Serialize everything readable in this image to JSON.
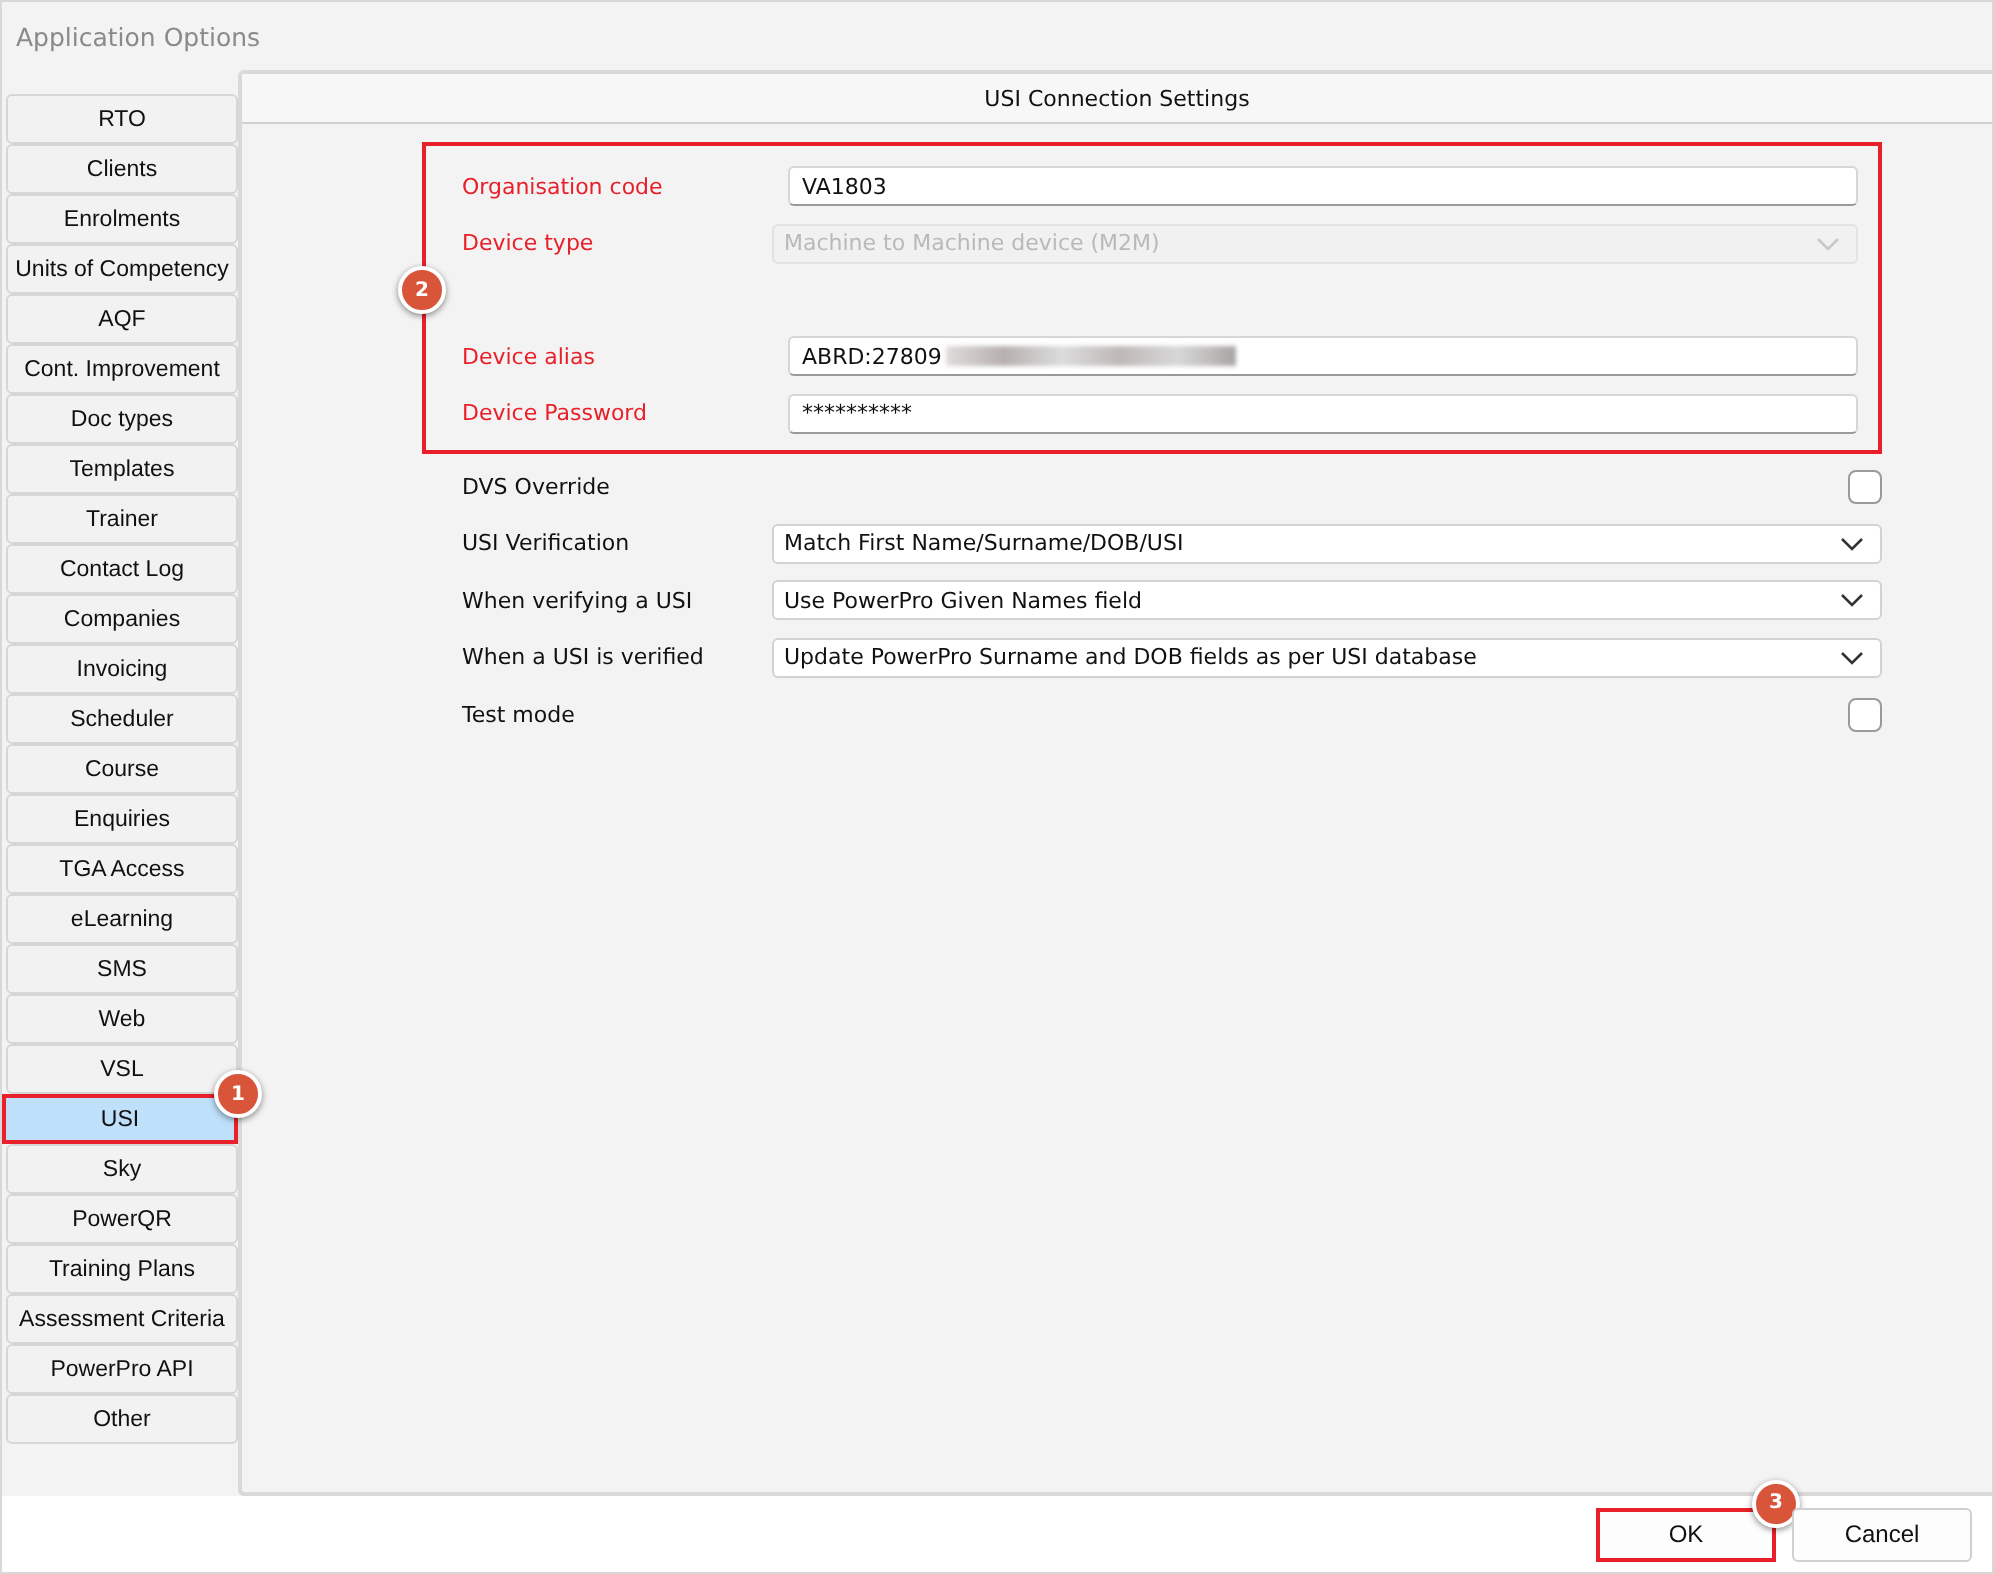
{
  "window": {
    "title": "Application Options"
  },
  "sidebar": {
    "items": [
      {
        "label": "RTO",
        "selected": false
      },
      {
        "label": "Clients",
        "selected": false
      },
      {
        "label": "Enrolments",
        "selected": false
      },
      {
        "label": "Units of Competency",
        "selected": false
      },
      {
        "label": "AQF",
        "selected": false
      },
      {
        "label": "Cont. Improvement",
        "selected": false
      },
      {
        "label": "Doc types",
        "selected": false
      },
      {
        "label": "Templates",
        "selected": false
      },
      {
        "label": "Trainer",
        "selected": false
      },
      {
        "label": "Contact Log",
        "selected": false
      },
      {
        "label": "Companies",
        "selected": false
      },
      {
        "label": "Invoicing",
        "selected": false
      },
      {
        "label": "Scheduler",
        "selected": false
      },
      {
        "label": "Course",
        "selected": false
      },
      {
        "label": "Enquiries",
        "selected": false
      },
      {
        "label": "TGA Access",
        "selected": false
      },
      {
        "label": "eLearning",
        "selected": false
      },
      {
        "label": "SMS",
        "selected": false
      },
      {
        "label": "Web",
        "selected": false
      },
      {
        "label": "VSL",
        "selected": false
      },
      {
        "label": "USI",
        "selected": true,
        "callout": "1"
      },
      {
        "label": "Sky",
        "selected": false
      },
      {
        "label": "PowerQR",
        "selected": false
      },
      {
        "label": "Training Plans",
        "selected": false
      },
      {
        "label": "Assessment Criteria",
        "selected": false
      },
      {
        "label": "PowerPro API",
        "selected": false
      },
      {
        "label": "Other",
        "selected": false
      }
    ]
  },
  "panel": {
    "title": "USI Connection Settings",
    "highlighted_group": {
      "callout": "2",
      "fields": [
        {
          "kind": "text",
          "label": "Organisation code",
          "value": "VA1803"
        },
        {
          "kind": "select",
          "label": "Device type",
          "value": "Machine to Machine device (M2M)",
          "disabled": true
        },
        {
          "kind": "spacer"
        },
        {
          "kind": "text",
          "label": "Device alias",
          "value": "ABRD:27809",
          "redacted": true
        },
        {
          "kind": "text",
          "label": "Device Password",
          "value": "**********"
        }
      ]
    },
    "fields": [
      {
        "kind": "checkbox",
        "label": "DVS Override",
        "checked": false
      },
      {
        "kind": "select",
        "label": "USI Verification",
        "value": "Match First Name/Surname/DOB/USI",
        "disabled": false
      },
      {
        "kind": "select",
        "label": "When verifying a USI",
        "value": "Use PowerPro Given Names field",
        "disabled": false
      },
      {
        "kind": "select",
        "label": "When a USI is verified",
        "value": "Update PowerPro Surname and DOB fields as per USI database",
        "disabled": false
      },
      {
        "kind": "checkbox",
        "label": "Test mode",
        "checked": false
      }
    ]
  },
  "buttons": [
    {
      "label": "OK",
      "callout": "3"
    },
    {
      "label": "Cancel"
    }
  ]
}
